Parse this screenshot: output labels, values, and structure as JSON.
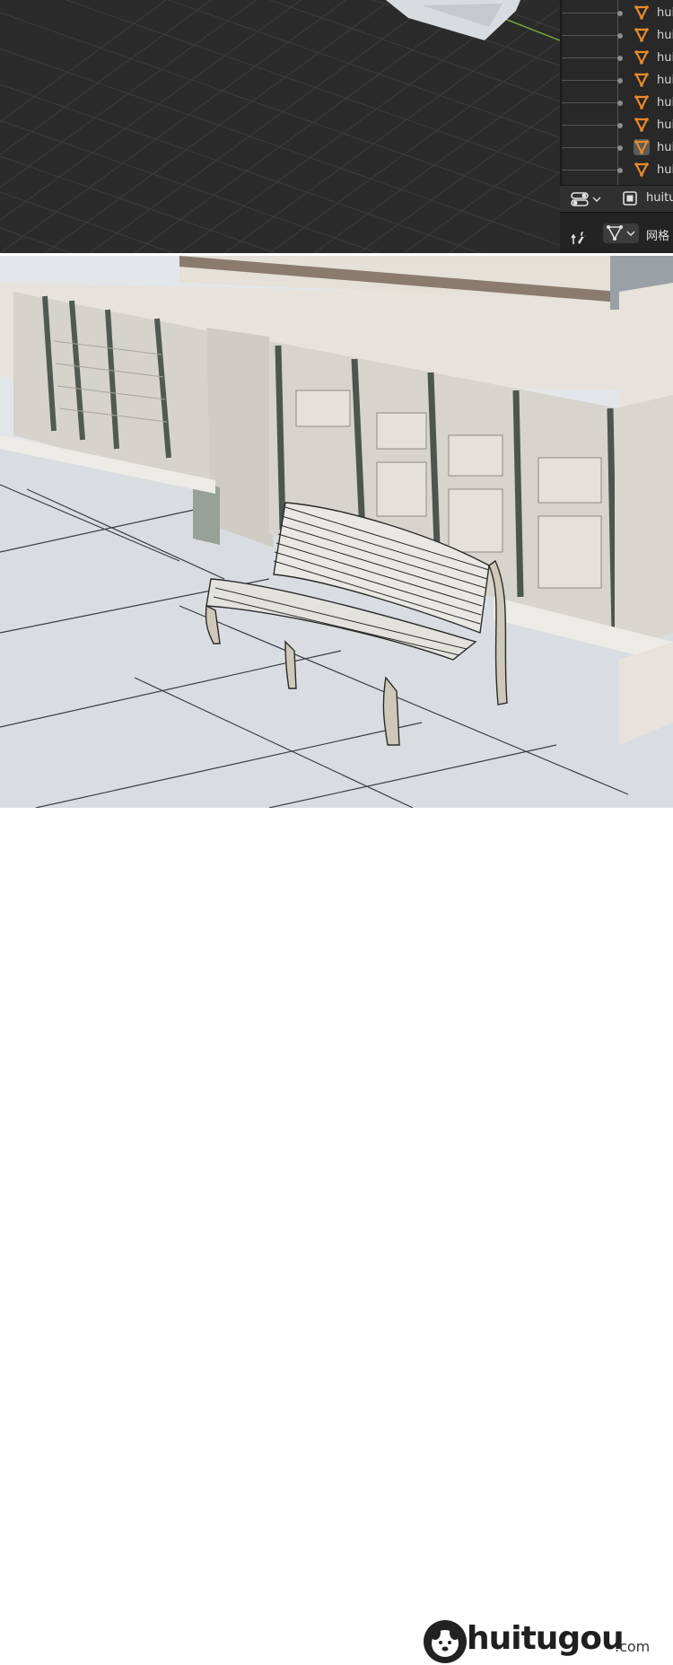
{
  "outliner": {
    "items": [
      {
        "label": "hui",
        "selected": false
      },
      {
        "label": "hui",
        "selected": false
      },
      {
        "label": "hui",
        "selected": false
      },
      {
        "label": "hui",
        "selected": false
      },
      {
        "label": "hui",
        "selected": false
      },
      {
        "label": "hui",
        "selected": false
      },
      {
        "label": "hui",
        "selected": true
      },
      {
        "label": "hui",
        "selected": false
      }
    ]
  },
  "properties": {
    "object_name": "huitu",
    "mesh_label": "网格"
  },
  "colors": {
    "viewport_bg": "#2a2a2a",
    "grid_line": "#3a3a3a",
    "axis_y": "#7aa03a",
    "mesh_orange": "#e88a2a",
    "wall": "#e7e3dc",
    "ground": "#dfe2e6",
    "cornice": "#8b7b6e"
  },
  "icons": {
    "mesh_object": "mesh-triangle-icon",
    "selection_toggle": "toggle-icon",
    "object_frame": "object-frame-icon",
    "tool_wrench": "wrench-icon",
    "mesh_funnel": "mesh-filter-icon"
  },
  "footer": {
    "brand": "huitugou",
    "domain_suffix": ".com"
  }
}
